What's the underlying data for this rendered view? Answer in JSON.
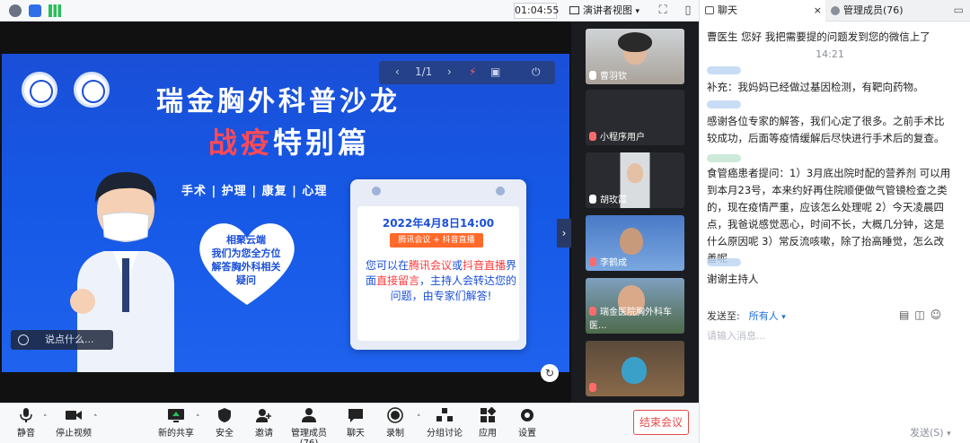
{
  "topbar": {
    "timer": "01:04:55",
    "presenter_view_label": "演讲者视图"
  },
  "slide": {
    "page_indicator": "1/1",
    "title_line1": "瑞金胸外科普沙龙",
    "title_line2_red": "战疫",
    "title_line2_white": "特别篇",
    "tags": "手术 | 护理 | 康复 | 心理",
    "heart_text": [
      "相聚云端",
      "我们为您全方位",
      "解答胸外科相关",
      "疑问"
    ],
    "board_date": "2022年4月8日14:00",
    "board_tag": "腾讯会议 + 抖音直播",
    "board_text": {
      "p1": "您可以在",
      "p1_red": "腾讯会议",
      "p2": "或",
      "p2_red": "抖音直播",
      "p3": "界面",
      "p3_red": "直接留言",
      "p4": "，主持人会转达您的问题，由专家们解答!"
    },
    "say_placeholder": "说点什么..."
  },
  "participants": [
    {
      "name": "曹羽钦"
    },
    {
      "name": "小程序用户"
    },
    {
      "name": "胡玫霞"
    },
    {
      "name": "李鹤成"
    },
    {
      "name": "瑞金医院胸外科车医..."
    },
    {
      "name": ""
    }
  ],
  "chat": {
    "tab_chat": "聊天",
    "tab_members": "管理成员(76)",
    "messages": [
      {
        "text": "曹医生  您好  我把需要提的问题发到您的微信上了"
      },
      {
        "time": "14:21"
      },
      {
        "text": "补充：我妈妈已经做过基因检测，有靶向药物。"
      },
      {
        "text": "感谢各位专家的解答，我们心定了很多。之前手术比较成功，后面等疫情缓解后尽快进行手术后的复查。"
      },
      {
        "text": "食管癌患者提问：1）3月底出院时配的营养剂  可以用到本月23号，本来约好再住院顺便做气管镜检查之类的，现在疫情严重，应该怎么处理呢  2）今天凌晨四点，我爸说感觉恶心，时间不长，大概几分钟，这是什么原因呢  3）常反流咳嗽，除了抬高睡觉，怎么改善呢"
      },
      {
        "text": "谢谢主持人"
      }
    ],
    "send_to_label": "发送至:",
    "send_to_value": "所有人",
    "input_placeholder": "请输入消息...",
    "send_button": "发送(S)"
  },
  "toolbar": {
    "mute": "静音",
    "stop_video": "停止视频",
    "new_share": "新的共享",
    "security": "安全",
    "invite": "邀请",
    "members": "管理成员(76)",
    "chat": "聊天",
    "record": "录制",
    "breakout": "分组讨论",
    "apps": "应用",
    "settings": "设置",
    "end_meeting": "结束会议"
  },
  "colors": {
    "slide_blue": "#1559e6",
    "accent_red": "#ff4a57",
    "end_red": "#e24b4b",
    "link_blue": "#1a6fe0"
  }
}
